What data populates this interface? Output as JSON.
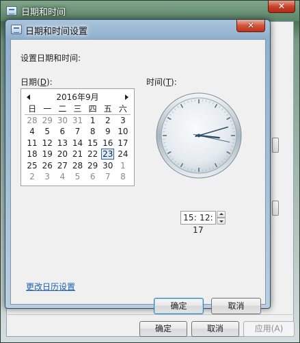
{
  "parent_window": {
    "title": "日期和时间",
    "close_glyph": "✕",
    "buttons": {
      "ok": "确定",
      "cancel": "取消",
      "apply": "应用(A)"
    }
  },
  "dialog": {
    "title": "日期和时间设置",
    "close_glyph": "✕",
    "heading": "设置日期和时间:",
    "date_label_pre": "日期(",
    "date_label_key": "D",
    "date_label_post": "):",
    "time_label_pre": "时间(",
    "time_label_key": "T",
    "time_label_post": "):",
    "calendar": {
      "month_title": "2016年9月",
      "weekdays": [
        "日",
        "一",
        "二",
        "三",
        "四",
        "五",
        "六"
      ],
      "weeks": [
        [
          {
            "d": "28",
            "other": true
          },
          {
            "d": "29",
            "other": true
          },
          {
            "d": "30",
            "other": true
          },
          {
            "d": "31",
            "other": true
          },
          {
            "d": "1"
          },
          {
            "d": "2"
          },
          {
            "d": "3"
          }
        ],
        [
          {
            "d": "4"
          },
          {
            "d": "5"
          },
          {
            "d": "6"
          },
          {
            "d": "7"
          },
          {
            "d": "8"
          },
          {
            "d": "9"
          },
          {
            "d": "10"
          }
        ],
        [
          {
            "d": "11"
          },
          {
            "d": "12"
          },
          {
            "d": "13"
          },
          {
            "d": "14"
          },
          {
            "d": "15"
          },
          {
            "d": "16"
          },
          {
            "d": "17"
          }
        ],
        [
          {
            "d": "18"
          },
          {
            "d": "19"
          },
          {
            "d": "20"
          },
          {
            "d": "21"
          },
          {
            "d": "22"
          },
          {
            "d": "23",
            "selected": true
          },
          {
            "d": "24"
          }
        ],
        [
          {
            "d": "25"
          },
          {
            "d": "26"
          },
          {
            "d": "27"
          },
          {
            "d": "28"
          },
          {
            "d": "29"
          },
          {
            "d": "30"
          },
          {
            "d": "1",
            "other": true
          }
        ],
        [
          {
            "d": "2",
            "other": true
          },
          {
            "d": "3",
            "other": true
          },
          {
            "d": "4",
            "other": true
          },
          {
            "d": "5",
            "other": true
          },
          {
            "d": "6",
            "other": true
          },
          {
            "d": "7",
            "other": true
          },
          {
            "d": "8",
            "other": true
          }
        ]
      ]
    },
    "clock": {
      "hour": 15,
      "minute": 12,
      "second": 17
    },
    "time_value": "15: 12: 17",
    "calendar_settings_link": "更改日历设置",
    "buttons": {
      "ok": "确定",
      "cancel": "取消"
    }
  },
  "colors": {
    "selection_border": "#2b5ea8",
    "link": "#1c5fb5",
    "clock_hands": "#2f4f66"
  }
}
